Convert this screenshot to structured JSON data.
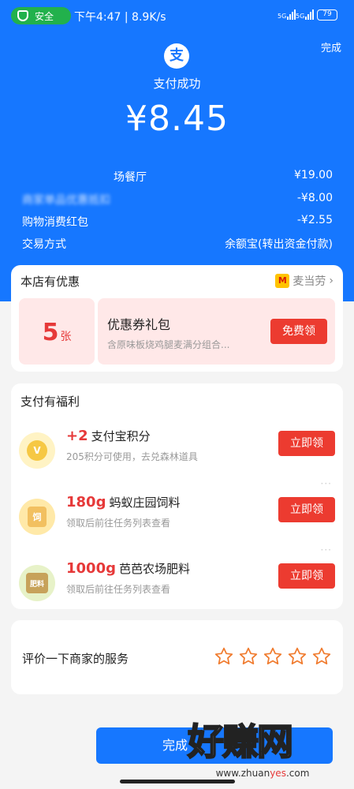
{
  "status_bar": {
    "safe_label": "安全",
    "time_speed": "下午4:47 | 8.9K/s",
    "sig1": "5G",
    "sig2": "5G",
    "battery": "79"
  },
  "header": {
    "done_label": "完成",
    "logo_char": "支",
    "title": "支付成功",
    "amount": "¥8.45"
  },
  "details": [
    {
      "label": "场餐厅",
      "value": "¥19.00"
    },
    {
      "label": "商家单品优惠抵扣",
      "value": "-¥8.00"
    },
    {
      "label": "购物消费红包",
      "value": "-¥2.55"
    },
    {
      "label": "交易方式",
      "value": "余额宝(转出资金付款)"
    }
  ],
  "store_offer": {
    "heading": "本店有优惠",
    "brand_logo": "M",
    "brand": "麦当劳",
    "chevron": "›",
    "count": "5",
    "unit": "张",
    "title": "优惠券礼包",
    "subtitle": "含原味板烧鸡腿麦满分组合...",
    "button": "免费领"
  },
  "benefits": {
    "heading": "支付有福利",
    "items": [
      {
        "highlight": "+2",
        "title": "支付宝积分",
        "sub": "205积分可使用，去兑森林道具",
        "button": "立即领",
        "icon_text": "V"
      },
      {
        "highlight": "180g",
        "title": "蚂蚁庄园饲料",
        "sub": "领取后前往任务列表查看",
        "button": "立即领",
        "icon_text": "饲"
      },
      {
        "highlight": "1000g",
        "title": "芭芭农场肥料",
        "sub": "领取后前往任务列表查看",
        "button": "立即领",
        "icon_text": "肥料"
      }
    ],
    "dots": "···"
  },
  "rating": {
    "label": "评价一下商家的服务",
    "stars": 5
  },
  "footer": {
    "done_label": "完成"
  },
  "watermark": {
    "big": "好赚网",
    "small_a": "www.zhuan",
    "small_b": "yes",
    "small_c": ".com"
  },
  "colors": {
    "primary": "#1677ff",
    "red": "#ec3b30",
    "safe_green": "#22b14c",
    "star": "#f07b2e"
  }
}
